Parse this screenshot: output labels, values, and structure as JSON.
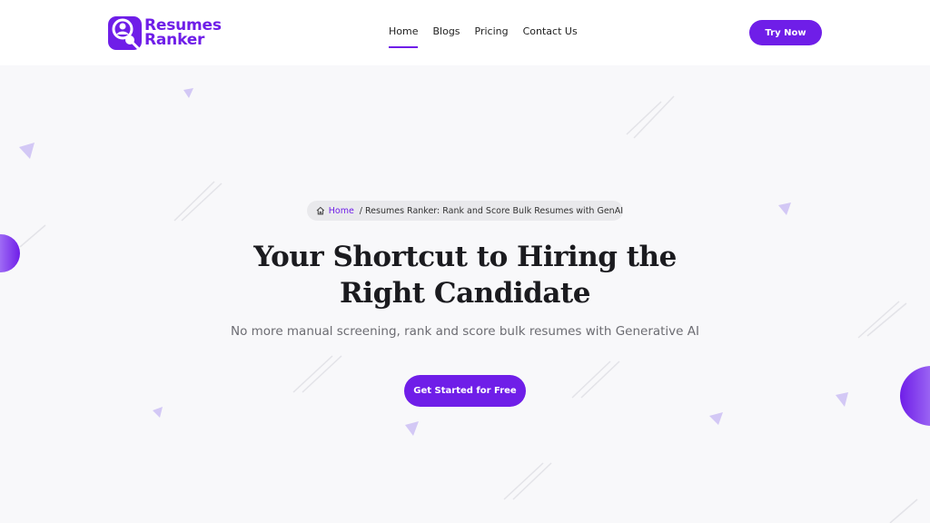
{
  "brand": {
    "line1": "Resumes",
    "line2": "Ranker",
    "accent": "#6f1ee8"
  },
  "nav": {
    "items": [
      {
        "label": "Home",
        "active": true
      },
      {
        "label": "Blogs",
        "active": false
      },
      {
        "label": "Pricing",
        "active": false
      },
      {
        "label": "Contact Us",
        "active": false
      }
    ]
  },
  "header": {
    "cta_label": "Try Now"
  },
  "breadcrumb": {
    "home_icon": "home-icon",
    "home_label": "Home",
    "separator": "/",
    "current": "Resumes Ranker: Rank and Score Bulk Resumes with GenAI"
  },
  "hero": {
    "title_line1": "Your Shortcut to Hiring the",
    "title_line2": "Right Candidate",
    "subtitle": "No more manual screening, rank and score bulk resumes with Generative AI",
    "cta_label": "Get Started for Free"
  }
}
